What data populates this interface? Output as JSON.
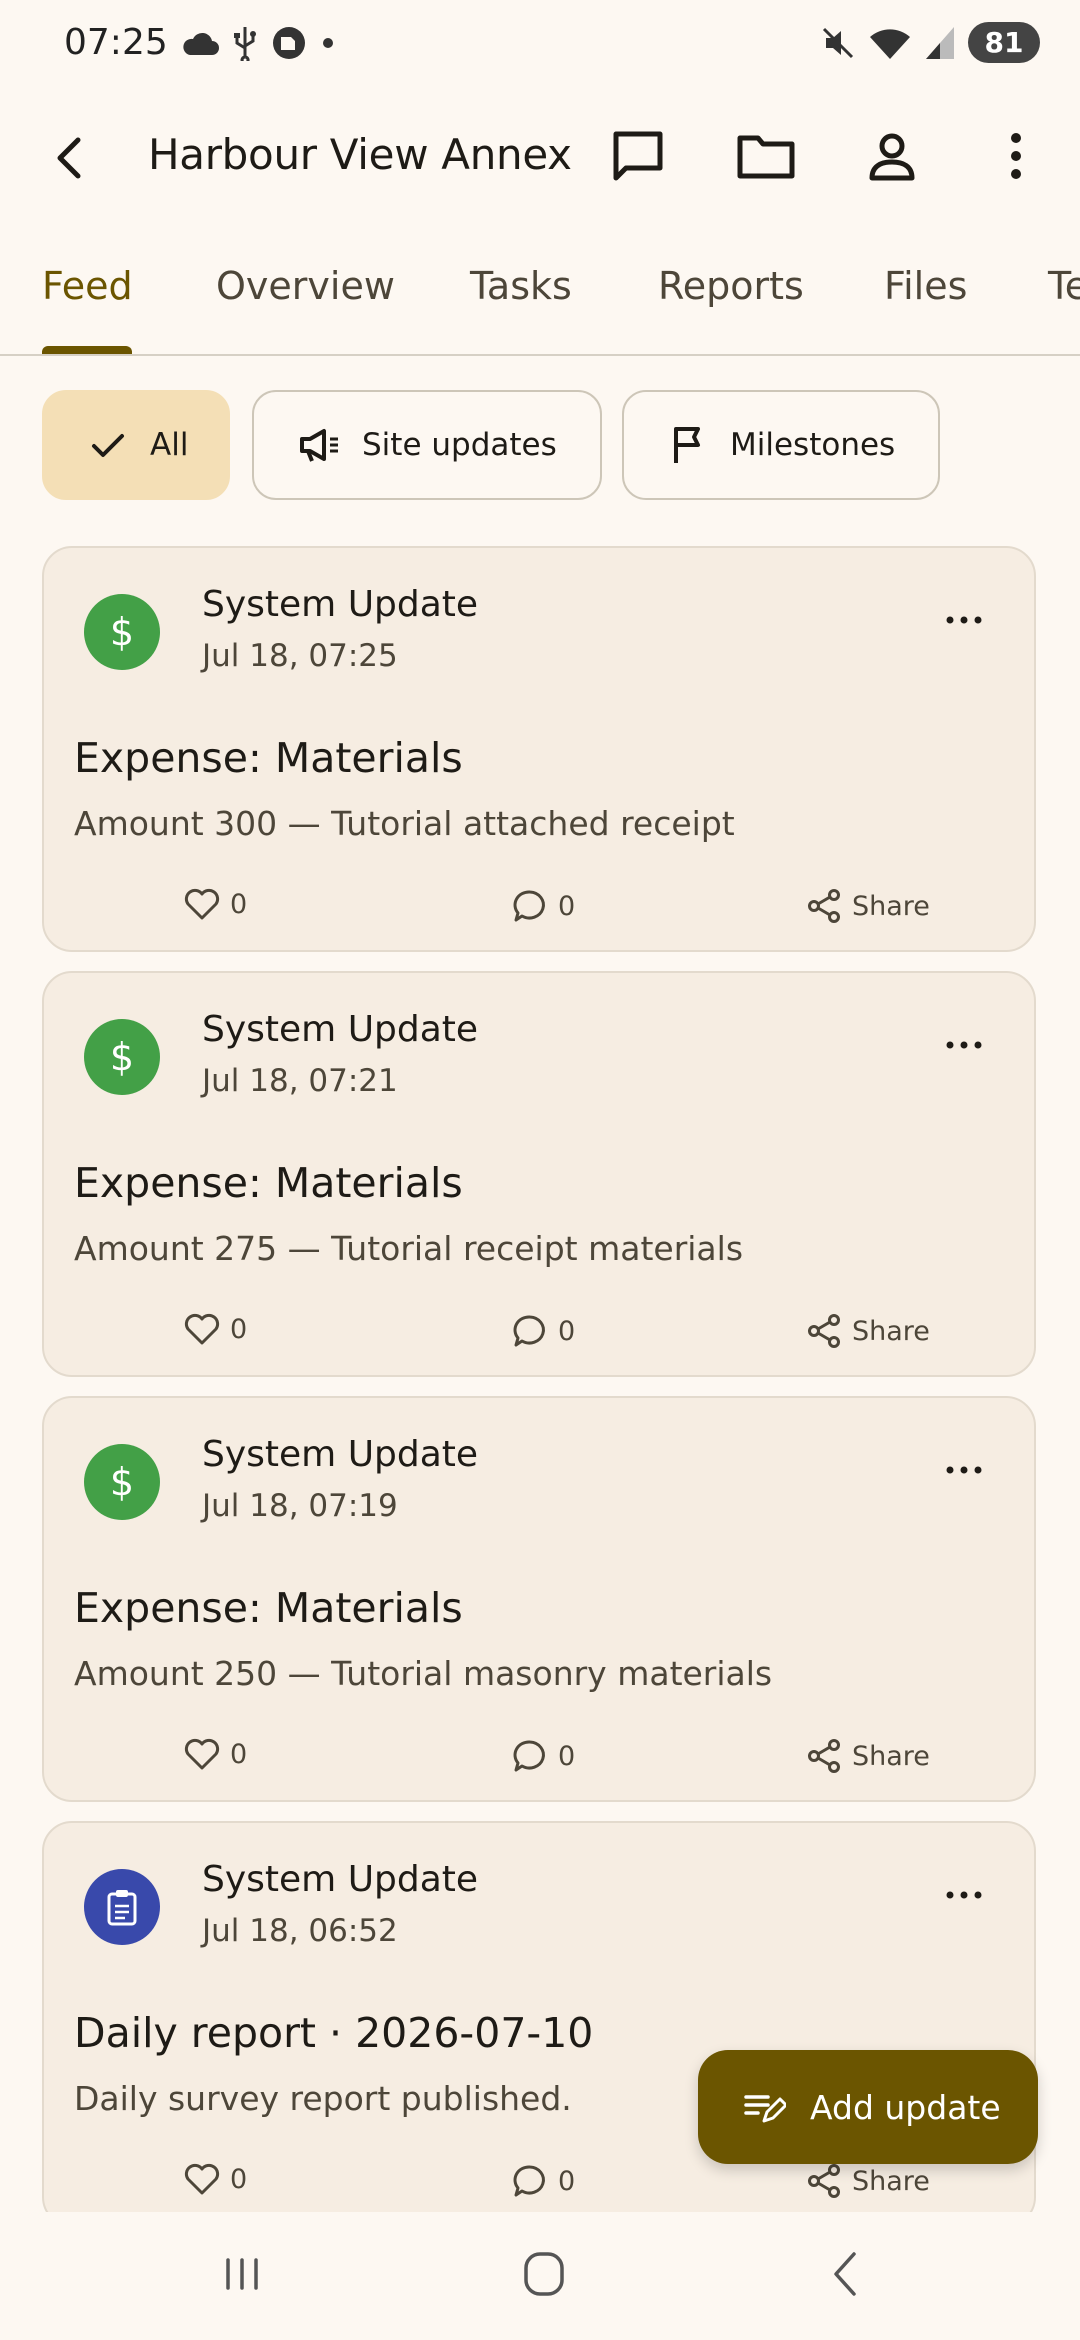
{
  "status_bar": {
    "time": "07:25",
    "battery": "81",
    "left_icons": [
      "cloud-icon",
      "usb-icon",
      "vpn-icon",
      "dot-icon"
    ],
    "right_icons": [
      "mute-icon",
      "wifi-icon",
      "signal-icon",
      "battery-icon"
    ]
  },
  "app_bar": {
    "title": "Harbour View Annex",
    "icons": [
      "back-arrow-icon",
      "chat-icon",
      "folder-icon",
      "person-icon",
      "more-vert-icon"
    ]
  },
  "tabs": [
    {
      "label": "Feed",
      "active": true
    },
    {
      "label": "Overview"
    },
    {
      "label": "Tasks"
    },
    {
      "label": "Reports"
    },
    {
      "label": "Files"
    },
    {
      "label": "Te"
    }
  ],
  "filters": [
    {
      "label": "All",
      "icon": "check-icon",
      "selected": true
    },
    {
      "label": "Site updates",
      "icon": "megaphone-icon"
    },
    {
      "label": "Milestones",
      "icon": "flag-icon"
    }
  ],
  "feed": [
    {
      "author": "System Update",
      "time": "Jul 18, 07:25",
      "title": "Expense: Materials",
      "body": "Amount 300 — Tutorial attached receipt",
      "likes": "0",
      "comments": "0",
      "share": "Share",
      "avatar_icon": "dollar-icon",
      "avatar_color": "#43a047"
    },
    {
      "author": "System Update",
      "time": "Jul 18, 07:21",
      "title": "Expense: Materials",
      "body": "Amount 275 — Tutorial receipt materials",
      "likes": "0",
      "comments": "0",
      "share": "Share",
      "avatar_icon": "dollar-icon",
      "avatar_color": "#43a047"
    },
    {
      "author": "System Update",
      "time": "Jul 18, 07:19",
      "title": "Expense: Materials",
      "body": "Amount 250 — Tutorial masonry materials",
      "likes": "0",
      "comments": "0",
      "share": "Share",
      "avatar_icon": "dollar-icon",
      "avatar_color": "#43a047"
    },
    {
      "author": "System Update",
      "time": "Jul 18, 06:52",
      "title": "Daily report · 2026-07-10",
      "body": "Daily survey report published.",
      "likes": "0",
      "comments": "0",
      "share": "Share",
      "avatar_icon": "clipboard-icon",
      "avatar_color": "#3949ab"
    }
  ],
  "fab": {
    "label": "Add update",
    "icon": "edit-note-icon"
  },
  "nav_bar": {
    "icons": [
      "recents-icon",
      "home-icon",
      "back-icon"
    ]
  },
  "colors": {
    "background": "#fdf8f2",
    "accent": "#6b5500",
    "chip_selected": "#f4dfb6",
    "card": "#f6ede2"
  }
}
